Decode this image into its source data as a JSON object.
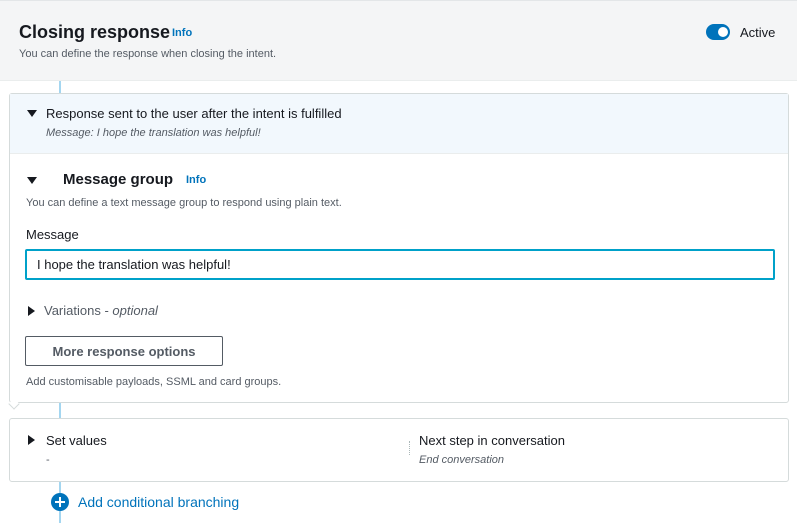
{
  "closing_response": {
    "title": "Closing response",
    "info_label": "Info",
    "description": "You can define the response when closing the intent.",
    "toggle_label": "Active",
    "toggle_on": true
  },
  "fulfilled_section": {
    "title": "Response sent to the user after the intent is fulfilled",
    "subtitle": "Message: I hope the translation was helpful!"
  },
  "message_group": {
    "title": "Message group",
    "info_label": "Info",
    "description": "You can define a text message group to respond using plain text.",
    "message_label": "Message",
    "message_value": "I hope the translation was helpful!",
    "variations_label": "Variations - ",
    "variations_optional": "optional",
    "more_options_button": "More response options",
    "more_options_description": "Add customisable payloads, SSML and card groups."
  },
  "set_values": {
    "title": "Set values",
    "value": "-"
  },
  "next_step": {
    "title": "Next step in conversation",
    "value": "End conversation"
  },
  "add_branching_label": "Add conditional branching",
  "colors": {
    "accent": "#0073bb",
    "focus_border": "#00a1c9",
    "header_bg": "#f4f5f6",
    "section_bg": "#f2f8fd",
    "connector": "#a4d6f0"
  },
  "icons": [
    "caret-down-icon",
    "caret-right-icon",
    "plus-circle-icon",
    "toggle-switch"
  ]
}
